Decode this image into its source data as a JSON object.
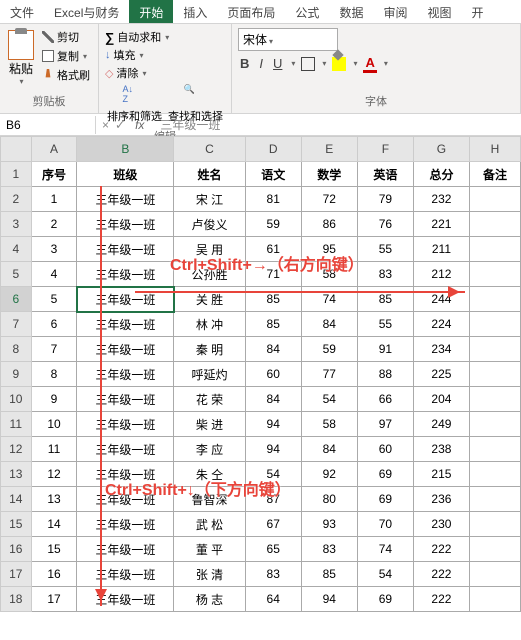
{
  "tabs": [
    "文件",
    "Excel与财务",
    "开始",
    "插入",
    "页面布局",
    "公式",
    "数据",
    "审阅",
    "视图",
    "开"
  ],
  "active_tab": 2,
  "ribbon": {
    "clipboard": {
      "paste": "粘贴",
      "cut": "剪切",
      "copy": "复制",
      "format_painter": "格式刷",
      "label": "剪贴板"
    },
    "editing": {
      "autosum": "自动求和",
      "fill": "填充",
      "clear": "清除",
      "sort": "排序和筛选",
      "find": "查找和选择",
      "label": "编辑"
    },
    "font": {
      "name": "宋体",
      "label": "字体",
      "b": "B",
      "i": "I",
      "u": "U",
      "a": "A"
    }
  },
  "namebox": "B6",
  "formula": "三年级一班",
  "columns": [
    "A",
    "B",
    "C",
    "D",
    "E",
    "F",
    "G",
    "H"
  ],
  "headers": [
    "序号",
    "班级",
    "姓名",
    "语文",
    "数学",
    "英语",
    "总分",
    "备注"
  ],
  "rows": [
    {
      "n": 1,
      "cls": "三年级一班",
      "name": "宋 江",
      "c": 81,
      "m": 72,
      "e": 79,
      "t": 232,
      "r": ""
    },
    {
      "n": 2,
      "cls": "三年级一班",
      "name": "卢俊义",
      "c": 59,
      "m": 86,
      "e": 76,
      "t": 221,
      "r": ""
    },
    {
      "n": 3,
      "cls": "三年级一班",
      "name": "吴 用",
      "c": 61,
      "m": 95,
      "e": 55,
      "t": 211,
      "r": ""
    },
    {
      "n": 4,
      "cls": "三年级一班",
      "name": "公孙胜",
      "c": 71,
      "m": 58,
      "e": 83,
      "t": 212,
      "r": ""
    },
    {
      "n": 5,
      "cls": "三年级一班",
      "name": "关 胜",
      "c": 85,
      "m": 74,
      "e": 85,
      "t": 244,
      "r": ""
    },
    {
      "n": 6,
      "cls": "三年级一班",
      "name": "林 冲",
      "c": 85,
      "m": 84,
      "e": 55,
      "t": 224,
      "r": ""
    },
    {
      "n": 7,
      "cls": "三年级一班",
      "name": "秦 明",
      "c": 84,
      "m": 59,
      "e": 91,
      "t": 234,
      "r": ""
    },
    {
      "n": 8,
      "cls": "三年级一班",
      "name": "呼延灼",
      "c": 60,
      "m": 77,
      "e": 88,
      "t": 225,
      "r": ""
    },
    {
      "n": 9,
      "cls": "三年级一班",
      "name": "花 荣",
      "c": 84,
      "m": 54,
      "e": 66,
      "t": 204,
      "r": ""
    },
    {
      "n": 10,
      "cls": "三年级一班",
      "name": "柴 进",
      "c": 94,
      "m": 58,
      "e": 97,
      "t": 249,
      "r": ""
    },
    {
      "n": 11,
      "cls": "三年级一班",
      "name": "李 应",
      "c": 94,
      "m": 84,
      "e": 60,
      "t": 238,
      "r": ""
    },
    {
      "n": 12,
      "cls": "三年级一班",
      "name": "朱 仝",
      "c": 54,
      "m": 92,
      "e": 69,
      "t": 215,
      "r": ""
    },
    {
      "n": 13,
      "cls": "三年级一班",
      "name": "鲁智深",
      "c": 87,
      "m": 80,
      "e": 69,
      "t": 236,
      "r": ""
    },
    {
      "n": 14,
      "cls": "三年级一班",
      "name": "武 松",
      "c": 67,
      "m": 93,
      "e": 70,
      "t": 230,
      "r": ""
    },
    {
      "n": 15,
      "cls": "三年级一班",
      "name": "董 平",
      "c": 65,
      "m": 83,
      "e": 74,
      "t": 222,
      "r": ""
    },
    {
      "n": 16,
      "cls": "三年级一班",
      "name": "张 清",
      "c": 83,
      "m": 85,
      "e": 54,
      "t": 222,
      "r": ""
    },
    {
      "n": 17,
      "cls": "三年级一班",
      "name": "杨 志",
      "c": 64,
      "m": 94,
      "e": 69,
      "t": 222,
      "r": ""
    }
  ],
  "selected": {
    "row": 6,
    "col": "B"
  },
  "annotations": {
    "right": "Ctrl+Shift+→（右方向键）",
    "down": "Ctrl+Shift+↓（下方向键）"
  }
}
